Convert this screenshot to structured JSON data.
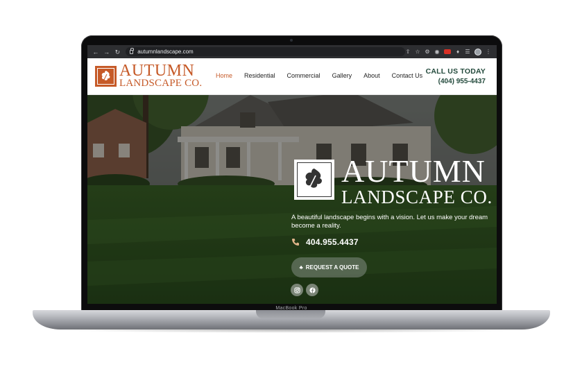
{
  "device": {
    "model_label": "MacBook Pro"
  },
  "browser": {
    "url": "autumnlandscape.com",
    "back_icon": "arrow-left-icon",
    "forward_icon": "arrow-right-icon",
    "reload_icon": "reload-icon"
  },
  "header": {
    "logo": {
      "line1": "AUTUMN",
      "line2": "LANDSCAPE CO."
    },
    "nav": [
      {
        "label": "Home",
        "active": true
      },
      {
        "label": "Residential",
        "active": false
      },
      {
        "label": "Commercial",
        "active": false
      },
      {
        "label": "Gallery",
        "active": false
      },
      {
        "label": "About",
        "active": false
      },
      {
        "label": "Contact Us",
        "active": false
      }
    ],
    "call": {
      "title": "CALL US TODAY",
      "number": "(404) 955-4437"
    }
  },
  "hero": {
    "logo": {
      "line1": "AUTUMN",
      "line2": "LANDSCAPE CO."
    },
    "tagline": "A beautiful landscape begins with a vision. Let us make your dream become a reality.",
    "phone": "404.955.4437",
    "cta_label": "REQUEST A QUOTE",
    "social": [
      "instagram-icon",
      "facebook-icon"
    ]
  },
  "colors": {
    "brand_orange": "#c65a28",
    "brand_green": "#234a3c",
    "nav_text": "#222222"
  }
}
